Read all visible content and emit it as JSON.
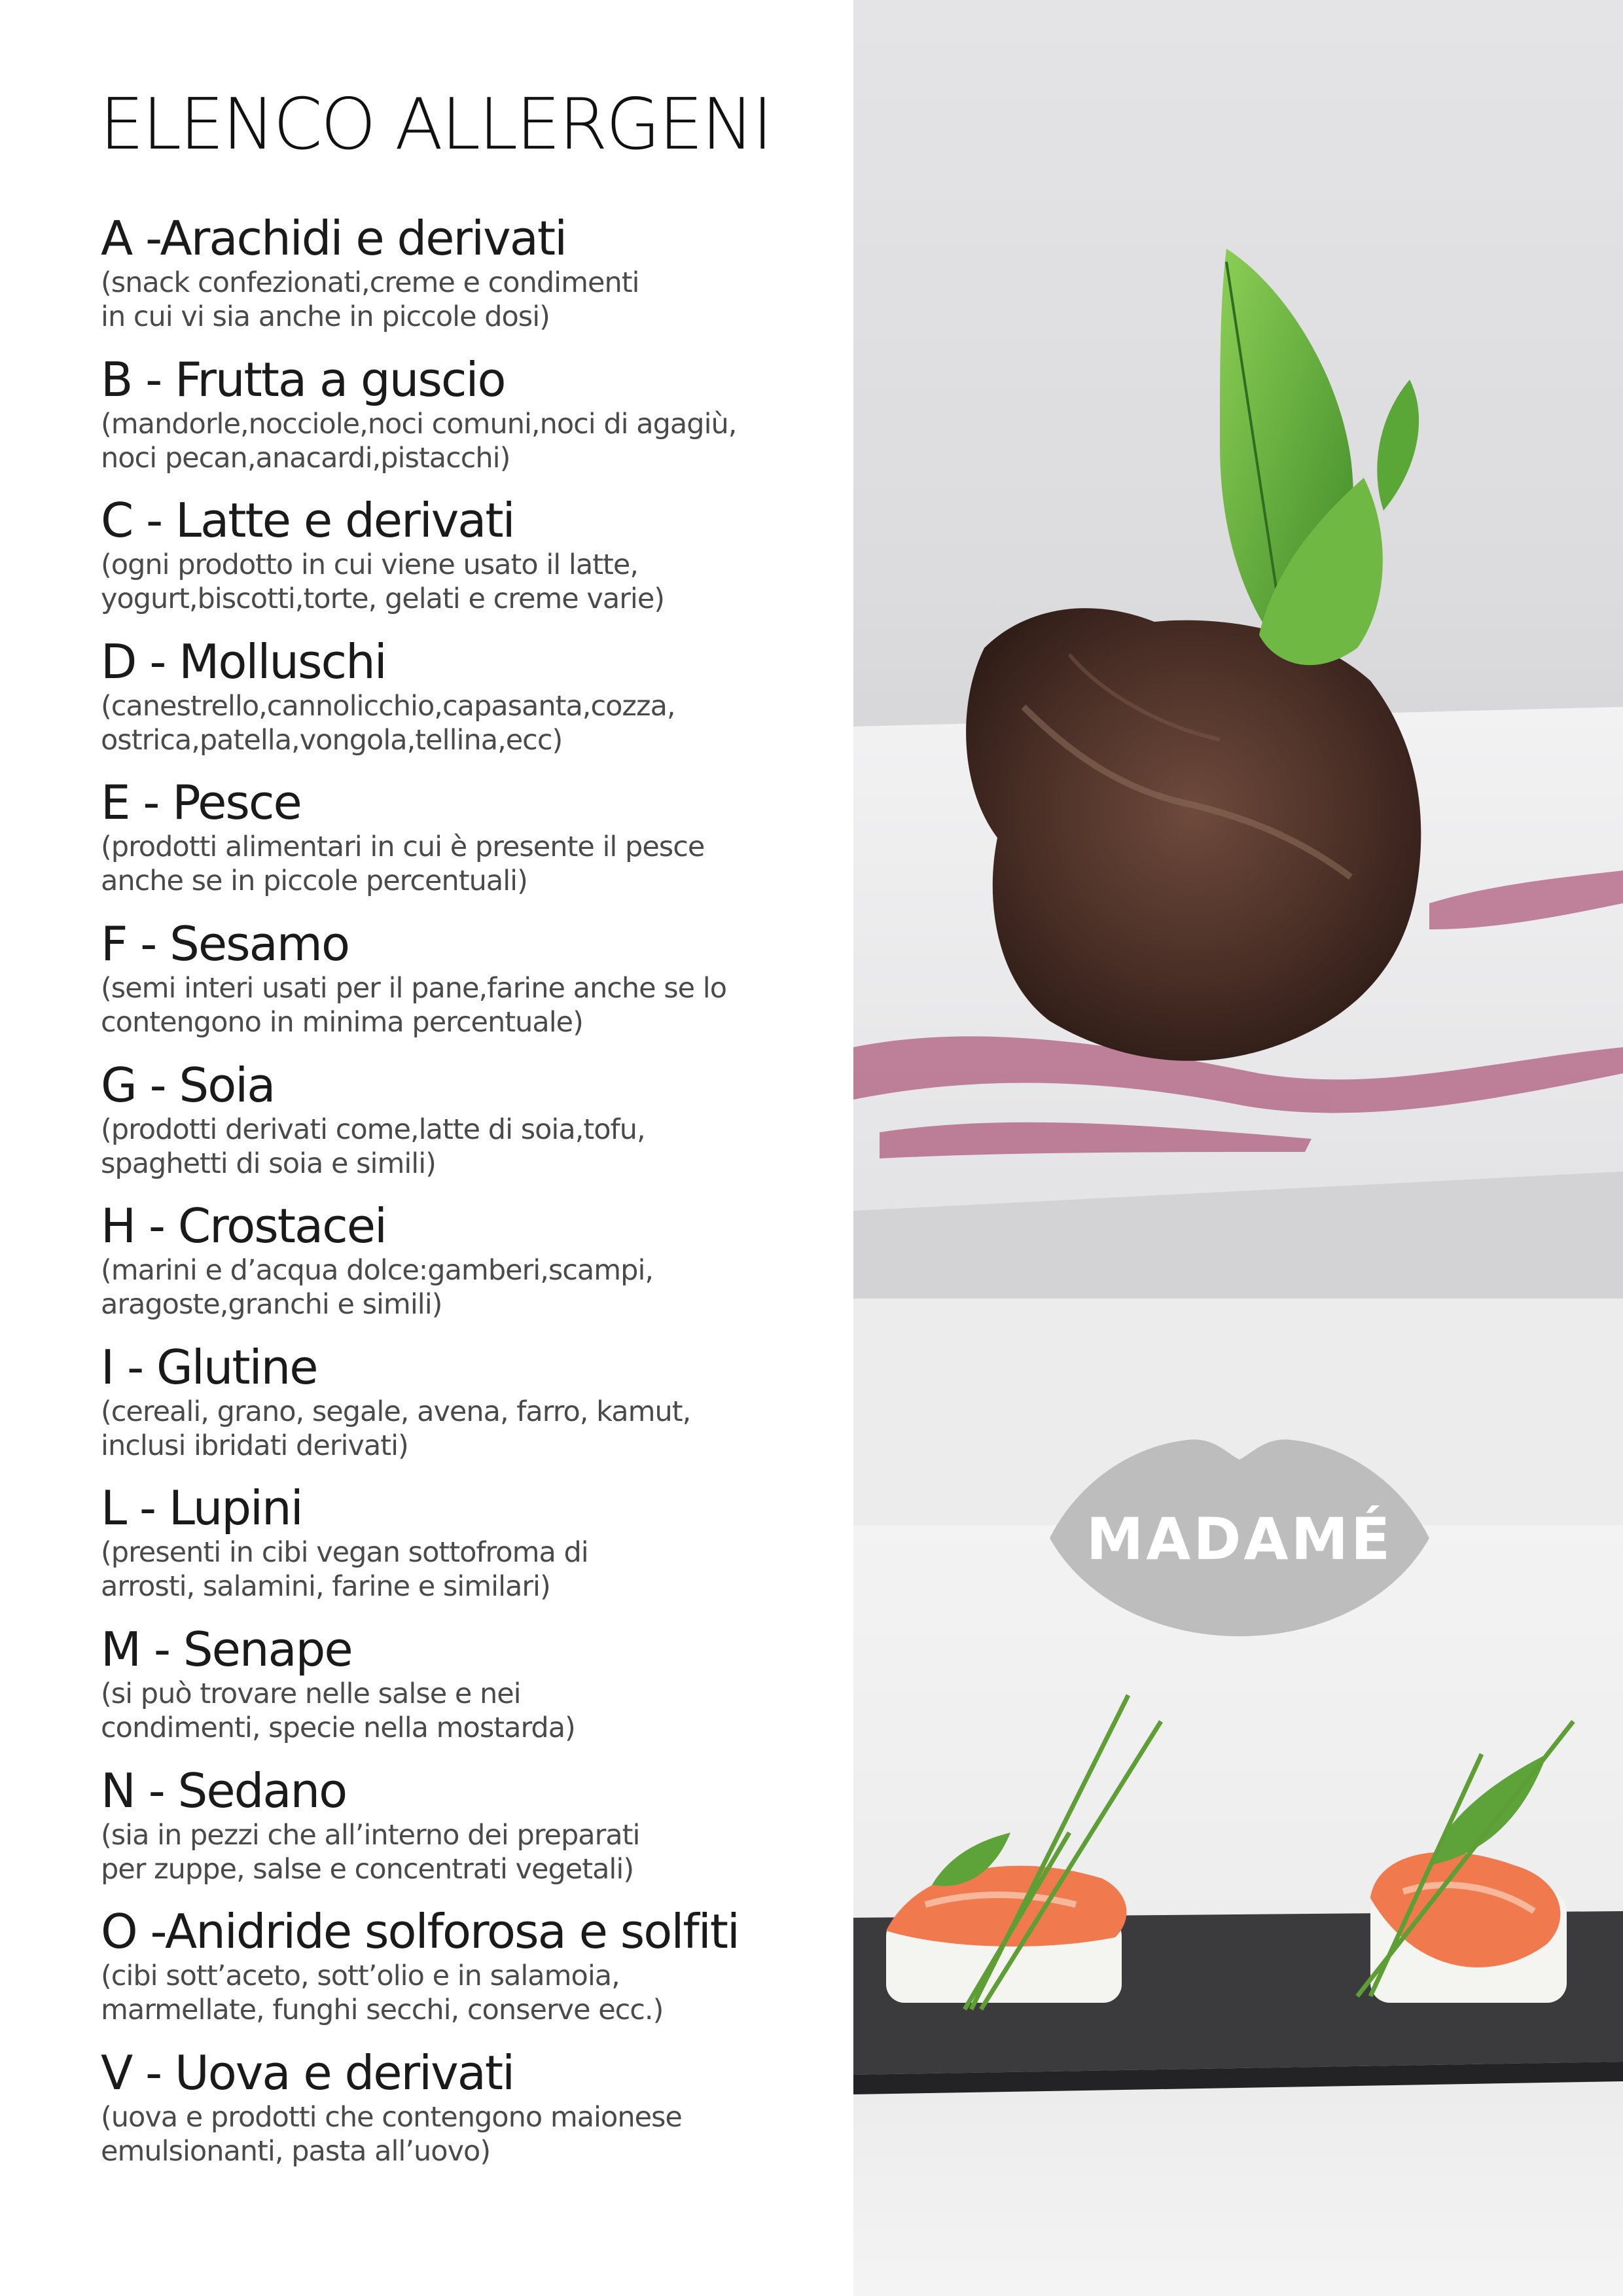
{
  "title": "ELENCO  ALLERGENI",
  "allergens": [
    {
      "title": "A -Arachidi e derivati",
      "desc": "(snack confezionati,creme e condimenti\nin cui vi sia anche in piccole dosi)"
    },
    {
      "title": "B - Frutta a guscio",
      "desc": "(mandorle,nocciole,noci comuni,noci di agagiù,\nnoci pecan,anacardi,pistacchi)"
    },
    {
      "title": "C - Latte e derivati",
      "desc": "(ogni prodotto in cui viene usato il latte,\nyogurt,biscotti,torte, gelati e creme varie)"
    },
    {
      "title": "D - Molluschi",
      "desc": "(canestrello,cannolicchio,capasanta,cozza,\nostrica,patella,vongola,tellina,ecc)"
    },
    {
      "title": "E - Pesce",
      "desc": "(prodotti alimentari in cui è presente il pesce\nanche se in piccole percentuali)"
    },
    {
      "title": "F - Sesamo",
      "desc": "(semi interi usati per il pane,farine anche se lo\ncontengono in minima percentuale)"
    },
    {
      "title": "G - Soia",
      "desc": "(prodotti derivati come,latte di soia,tofu,\nspaghetti di soia e simili)"
    },
    {
      "title": "H - Crostacei",
      "desc": "(marini e d’acqua dolce:gamberi,scampi,\naragoste,granchi e simili)"
    },
    {
      "title": "I - Glutine",
      "desc": "(cereali, grano, segale, avena, farro, kamut,\ninclusi ibridati derivati)"
    },
    {
      "title": "L - Lupini",
      "desc": "(presenti in cibi vegan sottofroma di\narrosti, salamini, farine e similari)"
    },
    {
      "title": "M - Senape",
      "desc": "(si può trovare nelle salse e nei\ncondimenti, specie nella mostarda)"
    },
    {
      "title": "N - Sedano",
      "desc": "(sia in pezzi che all’interno dei preparati\nper zuppe, salse e concentrati vegetali)"
    },
    {
      "title": "O -Anidride solforosa e solfiti",
      "desc": "(cibi sott’aceto, sott’olio e in salamoia,\nmarmellate, funghi secchi, conserve ecc.)"
    },
    {
      "title": "V - Uova e derivati",
      "desc": "(uova e prodotti che contengono maionese\nemulsionanti, pasta all’uovo)"
    }
  ],
  "logo": {
    "text": "MADAMÉ",
    "color": "#bdbdbd"
  },
  "photos": [
    {
      "name": "braised-meat-with-mint-photo"
    },
    {
      "name": "salmon-rice-bites-photo"
    }
  ]
}
